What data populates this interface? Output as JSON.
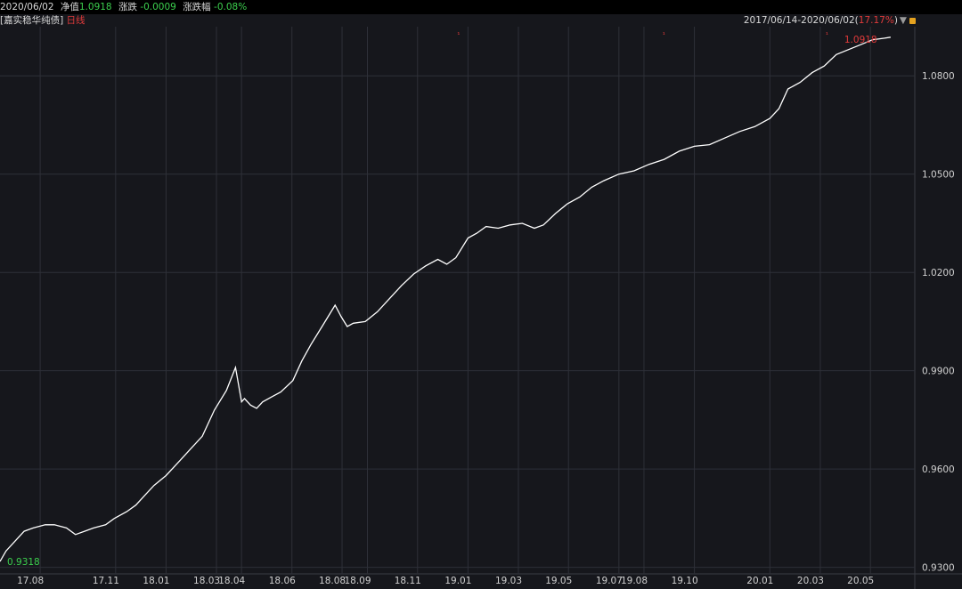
{
  "header": {
    "date": "2020/06/02",
    "nav_label": "净值",
    "nav_value": "1.0918",
    "change_label": "涨跌",
    "change_value": "-0.0009",
    "pct_label": "涨跌幅",
    "pct_value": "-0.08%"
  },
  "subheader": {
    "fund_name": "[嘉实稳华纯债]",
    "period": "日线"
  },
  "range": {
    "text": "2017/06/14-2020/06/02",
    "return_open": "(",
    "return_value": "17.17%",
    "return_close": ")"
  },
  "colors": {
    "background": "#16171c",
    "line": "#ffffff",
    "grid": "#2e3038",
    "green": "#3ccf4e",
    "red": "#e03a3a"
  },
  "chart_data": {
    "type": "line",
    "title": "",
    "xlabel": "",
    "ylabel": "",
    "ylim": [
      0.928,
      1.095
    ],
    "y_ticks": [
      "0.9300",
      "0.9600",
      "0.9900",
      "1.0200",
      "1.0500",
      "1.0800"
    ],
    "y_tick_values": [
      0.93,
      0.96,
      0.99,
      1.02,
      1.05,
      1.08
    ],
    "x_ticks": [
      "17.08",
      "17.11",
      "18.01",
      "18.03",
      "18.04",
      "18.06",
      "18.08",
      "18.09",
      "18.11",
      "19.01",
      "19.03",
      "19.05",
      "19.07",
      "19.08",
      "19.10",
      "20.01",
      "20.03",
      "20.05"
    ],
    "x_tick_values": [
      2017.583,
      2017.833,
      2018.0,
      2018.167,
      2018.25,
      2018.417,
      2018.583,
      2018.667,
      2018.833,
      2019.0,
      2019.167,
      2019.333,
      2019.5,
      2019.583,
      2019.75,
      2020.0,
      2020.167,
      2020.333
    ],
    "xlim": [
      2017.45,
      2020.48
    ],
    "start_label": "0.9318",
    "end_label": "1.0918",
    "series": [
      {
        "x": [
          2017.45,
          2017.47,
          2017.5,
          2017.53,
          2017.56,
          2017.6,
          2017.63,
          2017.67,
          2017.7,
          2017.73,
          2017.76,
          2017.8,
          2017.83,
          2017.87,
          2017.9,
          2017.93,
          2017.96,
          2018.0,
          2018.04,
          2018.08,
          2018.12,
          2018.16,
          2018.2,
          2018.23,
          2018.25,
          2018.26,
          2018.28,
          2018.3,
          2018.32,
          2018.35,
          2018.38,
          2018.42,
          2018.45,
          2018.48,
          2018.52,
          2018.56,
          2018.58,
          2018.6,
          2018.62,
          2018.66,
          2018.7,
          2018.74,
          2018.78,
          2018.82,
          2018.86,
          2018.9,
          2018.93,
          2018.96,
          2019.0,
          2019.03,
          2019.06,
          2019.1,
          2019.14,
          2019.18,
          2019.22,
          2019.25,
          2019.29,
          2019.33,
          2019.37,
          2019.41,
          2019.45,
          2019.5,
          2019.55,
          2019.6,
          2019.65,
          2019.7,
          2019.75,
          2019.8,
          2019.85,
          2019.9,
          2019.95,
          2020.0,
          2020.03,
          2020.06,
          2020.1,
          2020.14,
          2020.18,
          2020.22,
          2020.26,
          2020.3,
          2020.34,
          2020.38,
          2020.4
        ],
        "values": [
          0.9318,
          0.935,
          0.938,
          0.941,
          0.942,
          0.943,
          0.943,
          0.942,
          0.94,
          0.941,
          0.942,
          0.943,
          0.945,
          0.947,
          0.949,
          0.952,
          0.955,
          0.958,
          0.962,
          0.966,
          0.97,
          0.978,
          0.984,
          0.991,
          0.9805,
          0.9815,
          0.9795,
          0.9785,
          0.9805,
          0.982,
          0.9835,
          0.987,
          0.993,
          0.998,
          1.004,
          1.01,
          1.0065,
          1.0035,
          1.0045,
          1.005,
          1.008,
          1.012,
          1.016,
          1.0195,
          1.022,
          1.024,
          1.0225,
          1.0245,
          1.0305,
          1.032,
          1.034,
          1.0335,
          1.0345,
          1.035,
          1.0335,
          1.0345,
          1.038,
          1.041,
          1.043,
          1.046,
          1.048,
          1.05,
          1.051,
          1.053,
          1.0545,
          1.057,
          1.0585,
          1.059,
          1.061,
          1.063,
          1.0645,
          1.067,
          1.07,
          1.076,
          1.078,
          1.081,
          1.083,
          1.0865,
          1.088,
          1.0895,
          1.091,
          1.0915,
          1.0918
        ]
      }
    ],
    "markers": [
      {
        "x": 2018.97,
        "y": 1.0935
      },
      {
        "x": 2019.65,
        "y": 1.0935
      },
      {
        "x": 2020.19,
        "y": 1.0935
      }
    ]
  }
}
